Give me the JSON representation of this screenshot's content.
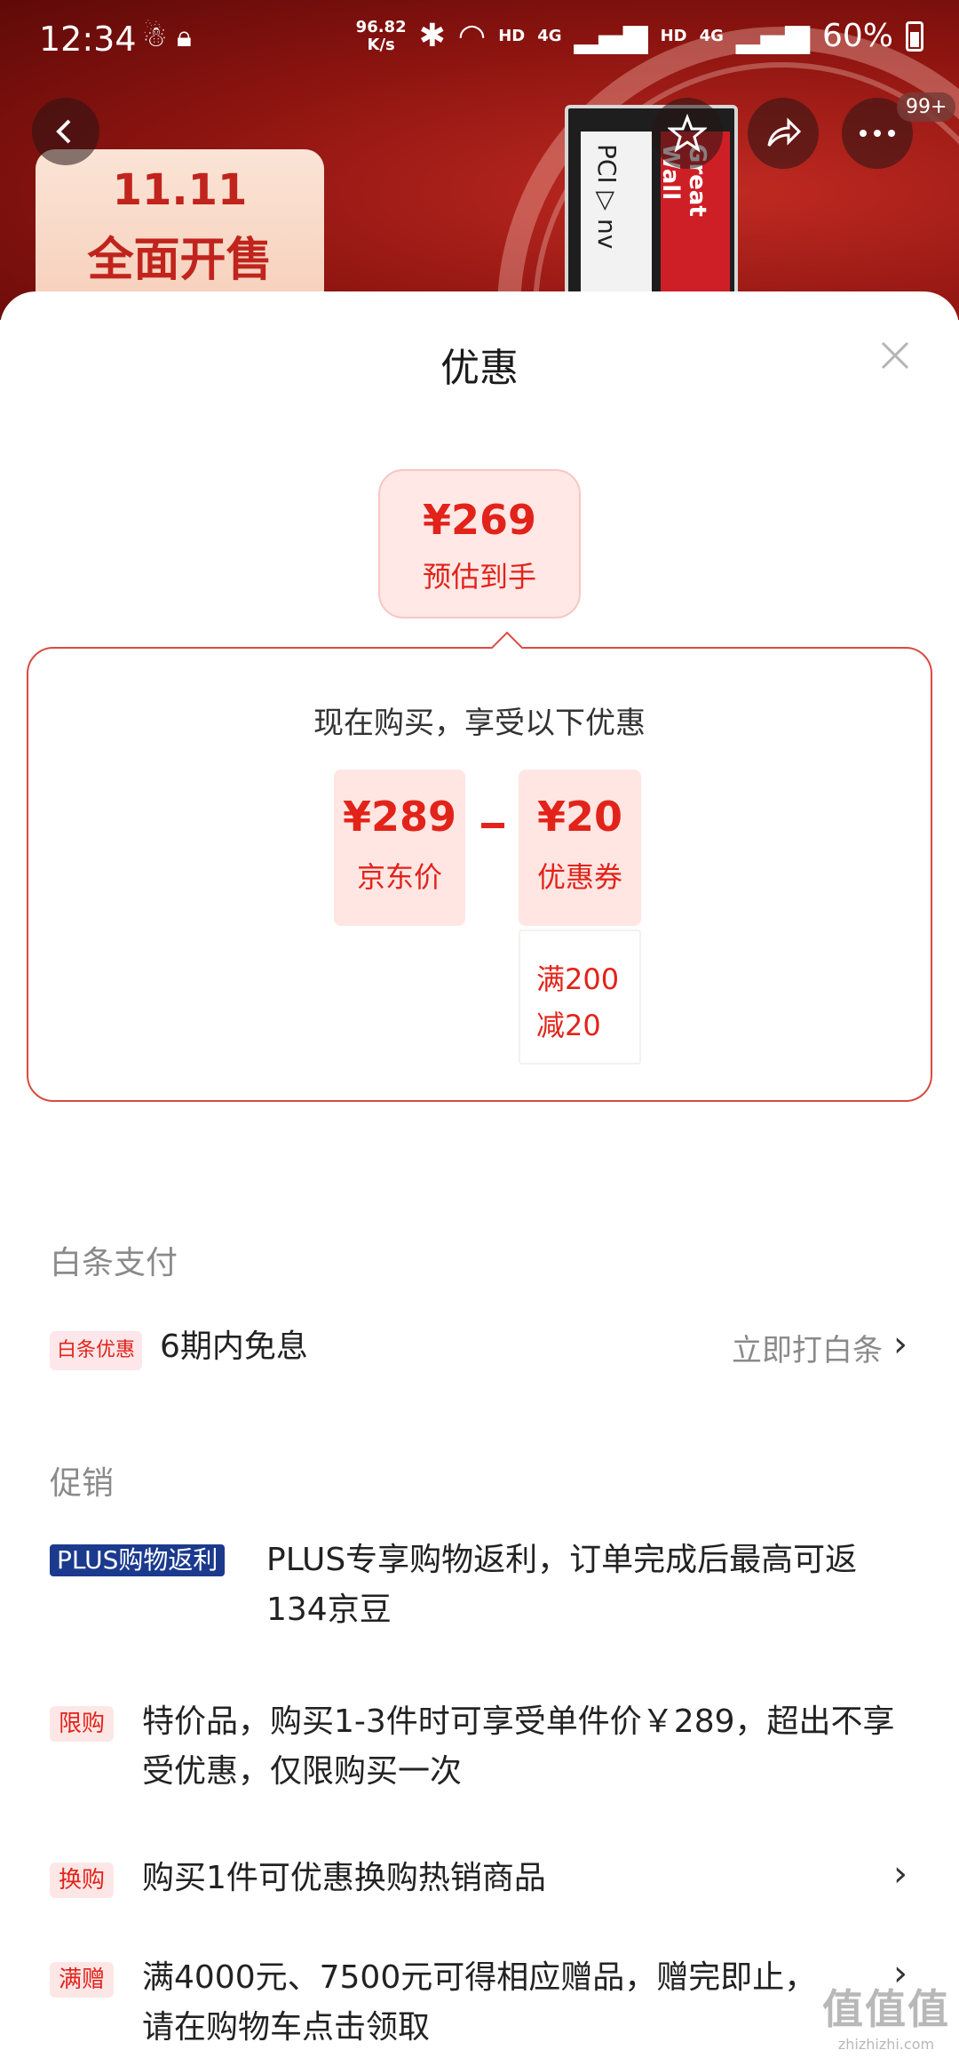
{
  "status_bar": {
    "time": "12:34",
    "net_speed_value": "96.82",
    "net_speed_unit": "K/s",
    "hd1": "HD",
    "sig1": "4G",
    "hd2": "HD",
    "sig2": "4G",
    "battery": "60%"
  },
  "banner": {
    "promo_line1": "11.11",
    "promo_line2": "全面开售",
    "ssd_text1": "PCI ▷ nv",
    "ssd_text2": "Great Wall",
    "more_badge": "99+"
  },
  "sheet": {
    "title": "优惠",
    "estimate": {
      "price": "¥269",
      "label": "预估到手"
    },
    "calc": {
      "heading": "现在购买，享受以下优惠",
      "jd_price": "¥289",
      "jd_label": "京东价",
      "coupon_price": "¥20",
      "coupon_label": "优惠券",
      "coupon_cond_line1": "满200",
      "coupon_cond_line2": "减20"
    },
    "baitiao": {
      "section_title": "白条支付",
      "tag": "白条优惠",
      "text": "6期内免息",
      "action": "立即打白条"
    },
    "promo": {
      "section_title": "促销",
      "items": [
        {
          "tag": "PLUS购物返利",
          "line1": "PLUS专享购物返利，订单完成后最高可返",
          "line2": "134京豆"
        },
        {
          "tag": "限购",
          "line1": "特价品，购买1-3件时可享受单件价￥289，超出不享",
          "line2": "受优惠，仅限购买一次"
        },
        {
          "tag": "换购",
          "line1": "购买1件可优惠换购热销商品",
          "line2": ""
        },
        {
          "tag": "满赠",
          "line1": "满4000元、7500元可得相应赠品，赠完即止，",
          "line2": "请在购物车点击领取"
        }
      ]
    }
  },
  "watermark": {
    "logo": "值值值",
    "url": "zhizhizhi.com"
  },
  "colors": {
    "accent_red": "#e2231a",
    "plus_blue": "#1b3a8e",
    "banner_red": "#8d1410"
  }
}
